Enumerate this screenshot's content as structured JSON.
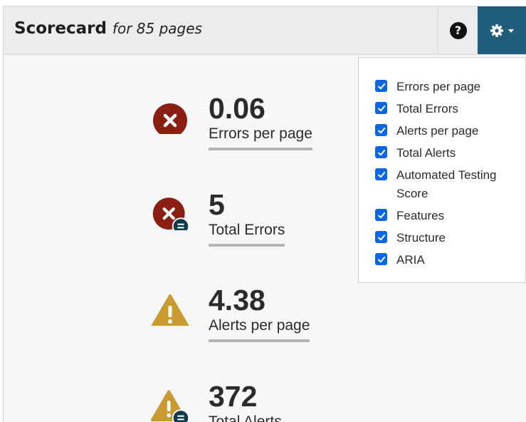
{
  "header": {
    "title": "Scorecard",
    "subtitle": "for 85 pages",
    "help_icon": "?",
    "settings_icon": "gear-icon"
  },
  "colors": {
    "settings_bg": "#1f5d7a",
    "error": "#8b1e12",
    "alert": "#c99a2e",
    "badge": "#0f3a4a",
    "checkbox": "#0b66e4"
  },
  "metrics": [
    {
      "value": "0.06",
      "label": "Errors per page",
      "icon": "error-icon"
    },
    {
      "value": "5",
      "label": "Total Errors",
      "icon": "error-total-icon"
    },
    {
      "value": "4.38",
      "label": "Alerts per page",
      "icon": "alert-icon"
    },
    {
      "value": "372",
      "label": "Total Alerts",
      "icon": "alert-total-icon"
    }
  ],
  "settings_menu": {
    "options": [
      {
        "label": "Errors per page",
        "checked": true
      },
      {
        "label": "Total Errors",
        "checked": true
      },
      {
        "label": "Alerts per page",
        "checked": true
      },
      {
        "label": "Total Alerts",
        "checked": true
      },
      {
        "label": "Automated Testing Score",
        "checked": true
      },
      {
        "label": "Features",
        "checked": true
      },
      {
        "label": "Structure",
        "checked": true
      },
      {
        "label": "ARIA",
        "checked": true
      }
    ]
  }
}
